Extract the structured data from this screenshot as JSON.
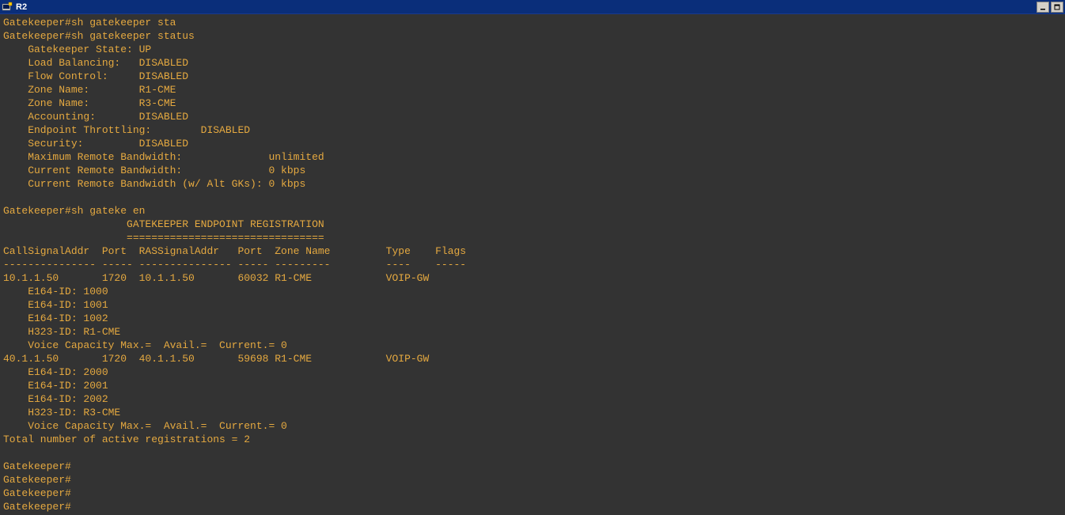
{
  "window": {
    "title": "R2",
    "icon_name": "putty-icon"
  },
  "terminal": {
    "lines": [
      "Gatekeeper#sh gatekeeper sta",
      "Gatekeeper#sh gatekeeper status",
      "    Gatekeeper State: UP",
      "    Load Balancing:   DISABLED",
      "    Flow Control:     DISABLED",
      "    Zone Name:        R1-CME",
      "    Zone Name:        R3-CME",
      "    Accounting:       DISABLED",
      "    Endpoint Throttling:        DISABLED",
      "    Security:         DISABLED",
      "    Maximum Remote Bandwidth:              unlimited",
      "    Current Remote Bandwidth:              0 kbps",
      "    Current Remote Bandwidth (w/ Alt GKs): 0 kbps",
      "",
      "Gatekeeper#sh gateke en",
      "                    GATEKEEPER ENDPOINT REGISTRATION",
      "                    ================================",
      "CallSignalAddr  Port  RASSignalAddr   Port  Zone Name         Type    Flags",
      "--------------- ----- --------------- ----- ---------         ----    -----",
      "10.1.1.50       1720  10.1.1.50       60032 R1-CME            VOIP-GW",
      "    E164-ID: 1000",
      "    E164-ID: 1001",
      "    E164-ID: 1002",
      "    H323-ID: R1-CME",
      "    Voice Capacity Max.=  Avail.=  Current.= 0",
      "40.1.1.50       1720  40.1.1.50       59698 R1-CME            VOIP-GW",
      "    E164-ID: 2000",
      "    E164-ID: 2001",
      "    E164-ID: 2002",
      "    H323-ID: R3-CME",
      "    Voice Capacity Max.=  Avail.=  Current.= 0",
      "Total number of active registrations = 2",
      "",
      "Gatekeeper#",
      "Gatekeeper#",
      "Gatekeeper#",
      "Gatekeeper#"
    ]
  }
}
